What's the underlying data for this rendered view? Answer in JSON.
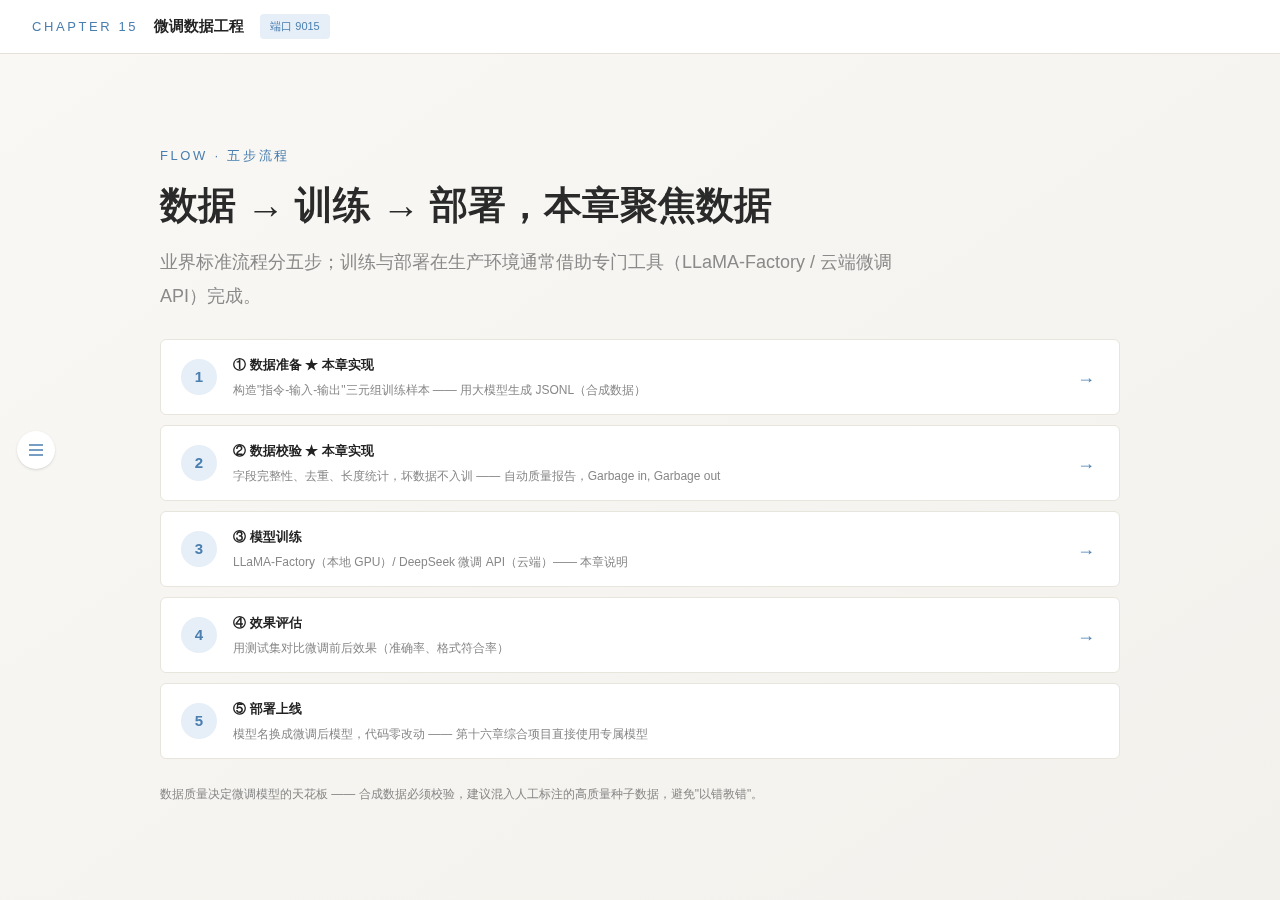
{
  "header": {
    "chapter": "CHAPTER 15",
    "title": "微调数据工程",
    "badge": "端口 9015"
  },
  "eyebrow": "FLOW · 五步流程",
  "heading": "数据 → 训练 → 部署，本章聚焦数据",
  "lead": "业界标准流程分五步；训练与部署在生产环境通常借助专门工具（LLaMA-Factory / 云端微调 API）完成。",
  "steps": [
    {
      "number": "1",
      "title": "① 数据准备 ★ 本章实现",
      "desc": "构造\"指令-输入-输出\"三元组训练样本 —— 用大模型生成 JSONL（合成数据）",
      "arrow": "→"
    },
    {
      "number": "2",
      "title": "② 数据校验 ★ 本章实现",
      "desc": "字段完整性、去重、长度统计，坏数据不入训 —— 自动质量报告，Garbage in, Garbage out",
      "arrow": "→"
    },
    {
      "number": "3",
      "title": "③ 模型训练",
      "desc": "LLaMA-Factory（本地 GPU）/ DeepSeek 微调 API（云端）—— 本章说明",
      "arrow": "→"
    },
    {
      "number": "4",
      "title": "④ 效果评估",
      "desc": "用测试集对比微调前后效果（准确率、格式符合率）",
      "arrow": "→"
    },
    {
      "number": "5",
      "title": "⑤ 部署上线",
      "desc": "模型名换成微调后模型，代码零改动 —— 第十六章综合项目直接使用专属模型"
    }
  ],
  "footnote": "数据质量决定微调模型的天花板 —— 合成数据必须校验，建议混入人工标注的高质量种子数据，避免\"以错教错\"。"
}
